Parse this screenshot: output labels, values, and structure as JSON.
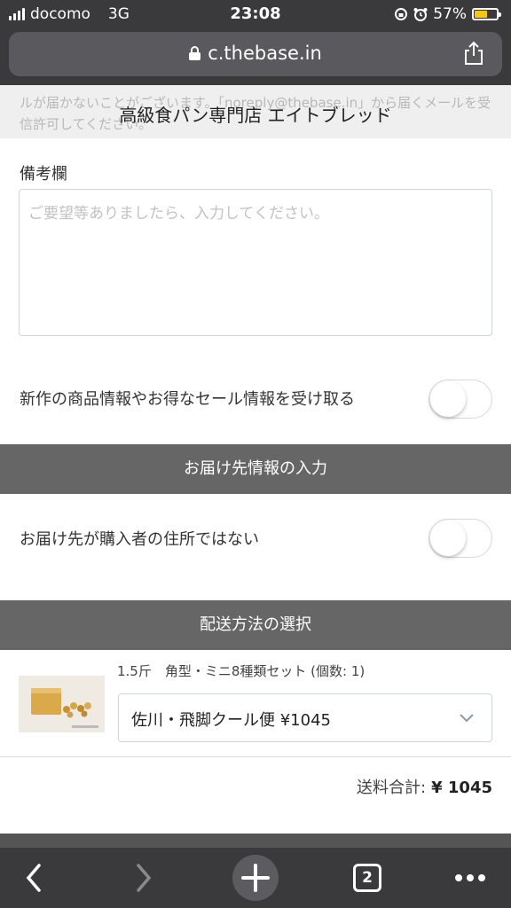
{
  "status_bar": {
    "carrier": "docomo",
    "network": "3G",
    "time": "23:08",
    "battery_text": "57%",
    "battery_level": 0.57,
    "battery_color": "#f5c518"
  },
  "browser": {
    "url": "c.thebase.in",
    "tab_count": "2"
  },
  "notice": {
    "line1": "ルが届かないことがございます。「noreply@thebase.in」から届くメールを受",
    "line2": "信許可してください。"
  },
  "shop_title": "高級食パン専門店 エイトブレッド",
  "remarks": {
    "label": "備考欄",
    "placeholder": "ご要望等ありましたら、入力してください。"
  },
  "newsletter_toggle": {
    "label": "新作の商品情報やお得なセール情報を受け取る",
    "checked": false
  },
  "delivery_section": {
    "header": "お届け先情報の入力",
    "toggle_label": "お届け先が購入者の住所ではない",
    "checked": false
  },
  "shipping_section": {
    "header": "配送方法の選択",
    "product_name": "1.5斤　角型・ミニ8種類セット (個数: 1)",
    "selected_method": "佐川・飛脚クール便 ¥1045",
    "total_label": "送料合計:",
    "total_value": "¥ 1045"
  },
  "icons": {
    "back": "chevron-left-icon",
    "forward": "chevron-right-icon",
    "new_tab": "plus-icon",
    "tabs": "tabs-icon",
    "more": "more-icon",
    "share": "share-icon",
    "lock": "lock-icon"
  }
}
